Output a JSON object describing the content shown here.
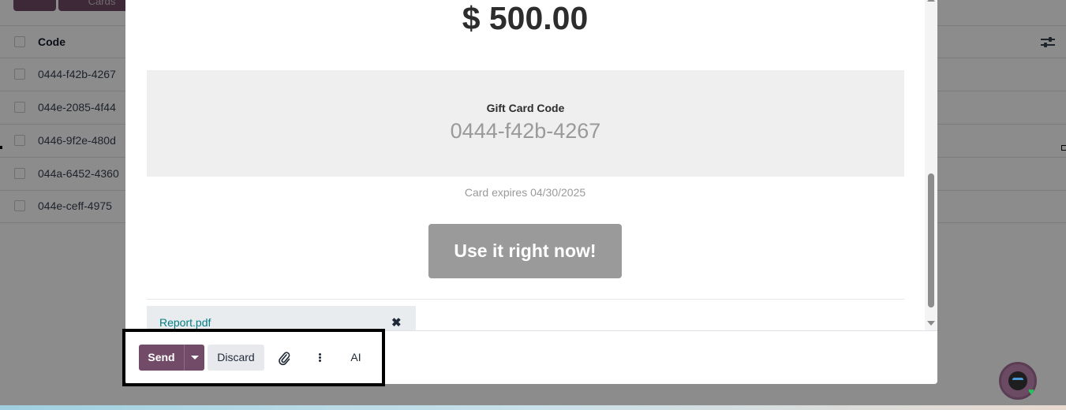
{
  "background": {
    "top_buttons": [
      "",
      "Cards"
    ],
    "table": {
      "header": "Code",
      "rows": [
        "0444-f42b-4267",
        "044e-2085-4f44",
        "0446-9f2e-480d",
        "044a-6452-4360",
        "044e-ceff-4975"
      ]
    }
  },
  "modal": {
    "amount": "$ 500.00",
    "gift_card_label": "Gift Card Code",
    "gift_card_code": "0444-f42b-4267",
    "expires": "Card expires 04/30/2025",
    "cta": "Use it right now!",
    "attachment": {
      "name": "Report.pdf",
      "remove_icon": "close-icon"
    },
    "footer": {
      "send": "Send",
      "discard": "Discard",
      "attach_icon": "paperclip-icon",
      "more_icon": "kebab-icon",
      "ai": "AI"
    }
  },
  "colors": {
    "primary": "#714b67",
    "link": "#017e84",
    "cta_bg": "#9a9a9a",
    "code_box_bg": "#efefef"
  }
}
